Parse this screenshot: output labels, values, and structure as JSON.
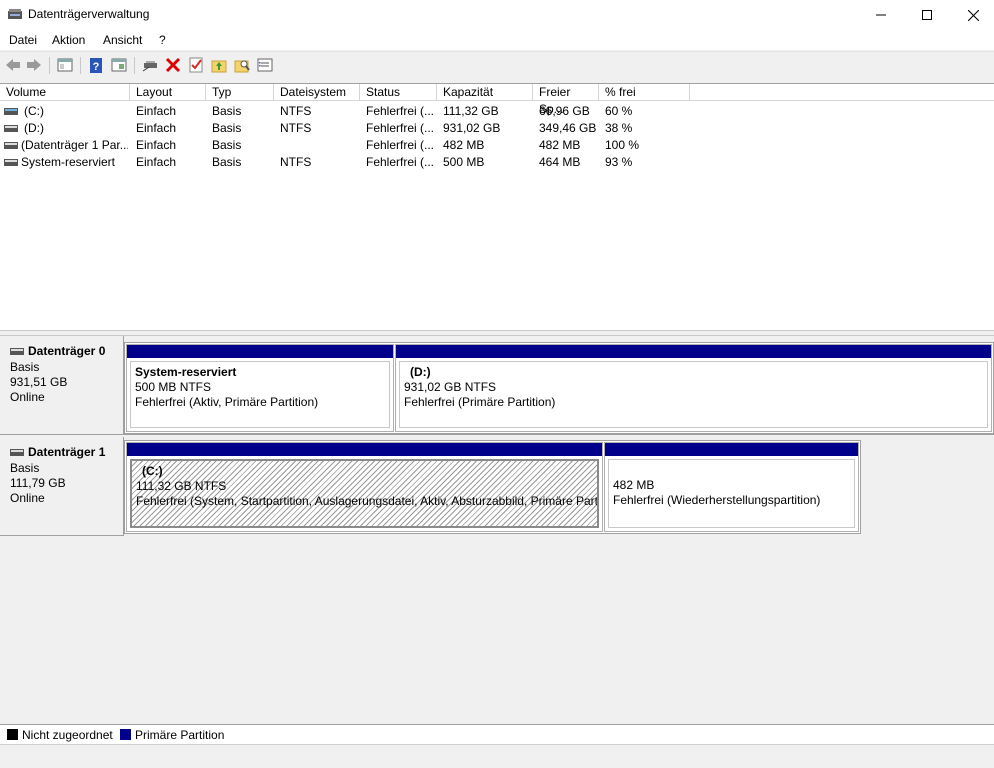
{
  "window": {
    "title": "Datenträgerverwaltung"
  },
  "menu": [
    "Datei",
    "Aktion",
    "Ansicht",
    "?"
  ],
  "toolbar": {
    "icons": [
      "back-icon",
      "forward-icon",
      "console-tree-icon",
      "help-icon",
      "show-action-pane-icon",
      "connect-disk-icon",
      "delete-icon",
      "properties-check-icon",
      "new-folder-up-icon",
      "search-folder-icon",
      "settings-list-icon"
    ]
  },
  "columns": [
    "Volume",
    "Layout",
    "Typ",
    "Dateisystem",
    "Status",
    "Kapazität",
    "Freier Sp...",
    "% frei"
  ],
  "volumes": [
    {
      "volume": "(C:)",
      "layout": "Einfach",
      "typ": "Basis",
      "fs": "NTFS",
      "status": "Fehlerfrei (...",
      "capacity": "111,32 GB",
      "free": "66,96 GB",
      "pct": "60 %"
    },
    {
      "volume": "(D:)",
      "layout": "Einfach",
      "typ": "Basis",
      "fs": "NTFS",
      "status": "Fehlerfrei (...",
      "capacity": "931,02 GB",
      "free": "349,46 GB",
      "pct": "38 %"
    },
    {
      "volume": "(Datenträger 1 Par...",
      "layout": "Einfach",
      "typ": "Basis",
      "fs": "",
      "status": "Fehlerfrei (...",
      "capacity": "482 MB",
      "free": "482 MB",
      "pct": "100 %"
    },
    {
      "volume": "System-reserviert",
      "layout": "Einfach",
      "typ": "Basis",
      "fs": "NTFS",
      "status": "Fehlerfrei (...",
      "capacity": "500 MB",
      "free": "464 MB",
      "pct": "93 %"
    }
  ],
  "disks": [
    {
      "name": "Datenträger 0",
      "type": "Basis",
      "size": "931,51 GB",
      "state": "Online",
      "partitions": [
        {
          "title": "System-reserviert",
          "line1": "500 MB NTFS",
          "line2": "Fehlerfrei (Aktiv, Primäre Partition)"
        },
        {
          "title": "(D:)",
          "line1": "931,02 GB NTFS",
          "line2": "Fehlerfrei (Primäre Partition)"
        }
      ]
    },
    {
      "name": "Datenträger 1",
      "type": "Basis",
      "size": "111,79 GB",
      "state": "Online",
      "partitions": [
        {
          "title": "(C:)",
          "line1": "111,32 GB NTFS",
          "line2": "Fehlerfrei (System, Startpartition, Auslagerungsdatei, Aktiv, Absturzabbild, Primäre Partit"
        },
        {
          "title": "",
          "line1": "482 MB",
          "line2": "Fehlerfrei (Wiederherstellungspartition)"
        }
      ]
    }
  ],
  "legend": [
    {
      "label": "Nicht zugeordnet",
      "color": "#000000"
    },
    {
      "label": "Primäre Partition",
      "color": "#00008b"
    }
  ]
}
